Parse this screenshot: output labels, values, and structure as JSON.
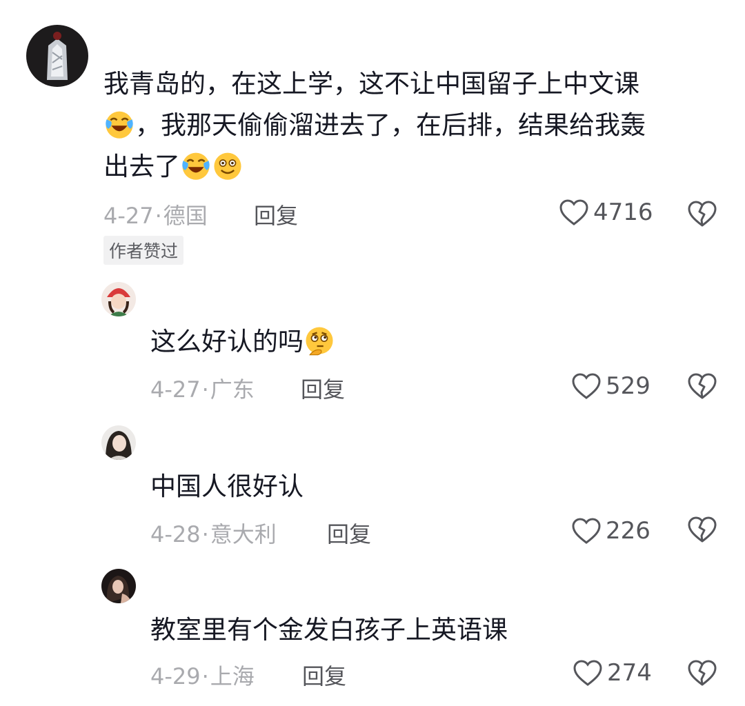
{
  "comments": [
    {
      "text_lines": [
        "我青岛的，在这上学，这不让中国留子上中文课",
        "，我那天偷偷溜进去了，在后排，结果给我轰",
        "出去了"
      ],
      "date": "4-27",
      "location": "德国",
      "reply_label": "回复",
      "likes": "4716",
      "badge": "作者赞过"
    },
    {
      "text": "这么好认的吗",
      "date": "4-27",
      "location": "广东",
      "reply_label": "回复",
      "likes": "529"
    },
    {
      "text": "中国人很好认",
      "date": "4-28",
      "location": "意大利",
      "reply_label": "回复",
      "likes": "226"
    },
    {
      "text": "教室里有个金发白孩子上英语课",
      "date": "4-29",
      "location": "上海",
      "reply_label": "回复",
      "likes": "274"
    }
  ],
  "separator": "·",
  "colors": {
    "text": "#161823",
    "meta": "#a9aaae",
    "reply": "#54555a",
    "icon": "#55565b",
    "badge_bg": "#f1f1f2",
    "emoji_yellow": "#ffc83d"
  }
}
